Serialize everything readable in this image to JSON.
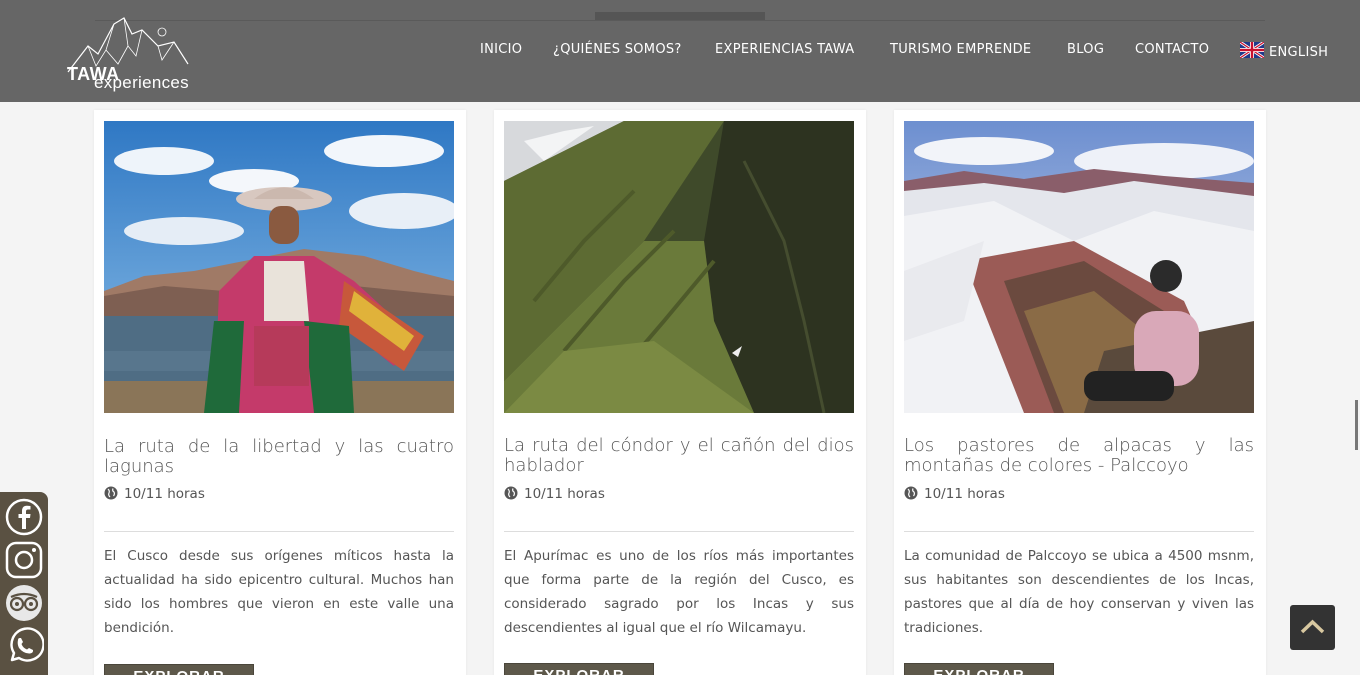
{
  "header": {
    "logo": {
      "brand": "TAWA",
      "sub": "experiences"
    },
    "nav": [
      {
        "label": "INICIO"
      },
      {
        "label": "¿QUIÉNES SOMOS?"
      },
      {
        "label": "EXPERIENCIAS TAWA"
      },
      {
        "label": "TURISMO EMPRENDE"
      },
      {
        "label": "BLOG"
      },
      {
        "label": "CONTACTO"
      },
      {
        "label": "ENGLISH",
        "icon": "uk-flag-icon"
      }
    ]
  },
  "cards": [
    {
      "title": "La ruta de la libertad y las cuatro lagunas",
      "duration": "10/11 horas",
      "description": "El Cusco desde sus orígenes míticos hasta la actualidad ha sido epicentro cultural. Muchos han sido los hombres que vieron en este valle una bendición.",
      "button": "EXPLORAR"
    },
    {
      "title": "La ruta del cóndor y el cañón del dios hablador",
      "duration": "10/11 horas",
      "description": "El Apurímac es uno de los ríos más importantes que forma parte de la región del Cusco, es considerado sagrado por los Incas y sus descendientes al igual que el río Wilcamayu.",
      "button": "EXPLORAR"
    },
    {
      "title": "Los pastores de alpacas y las montañas de colores - Palccoyo",
      "duration": "10/11 horas",
      "description": "La comunidad de Palccoyo se ubica a 4500 msnm, sus habitantes son descendientes de los Incas, pastores que al día de hoy conservan y viven las tradiciones.",
      "button": "EXPLORAR"
    }
  ],
  "social": [
    "facebook-icon",
    "instagram-icon",
    "tripadvisor-icon",
    "whatsapp-icon"
  ],
  "colors": {
    "header_bg": "#666666",
    "button_bg": "#5d584a",
    "social_bg": "#5a5142",
    "text": "#555555"
  }
}
